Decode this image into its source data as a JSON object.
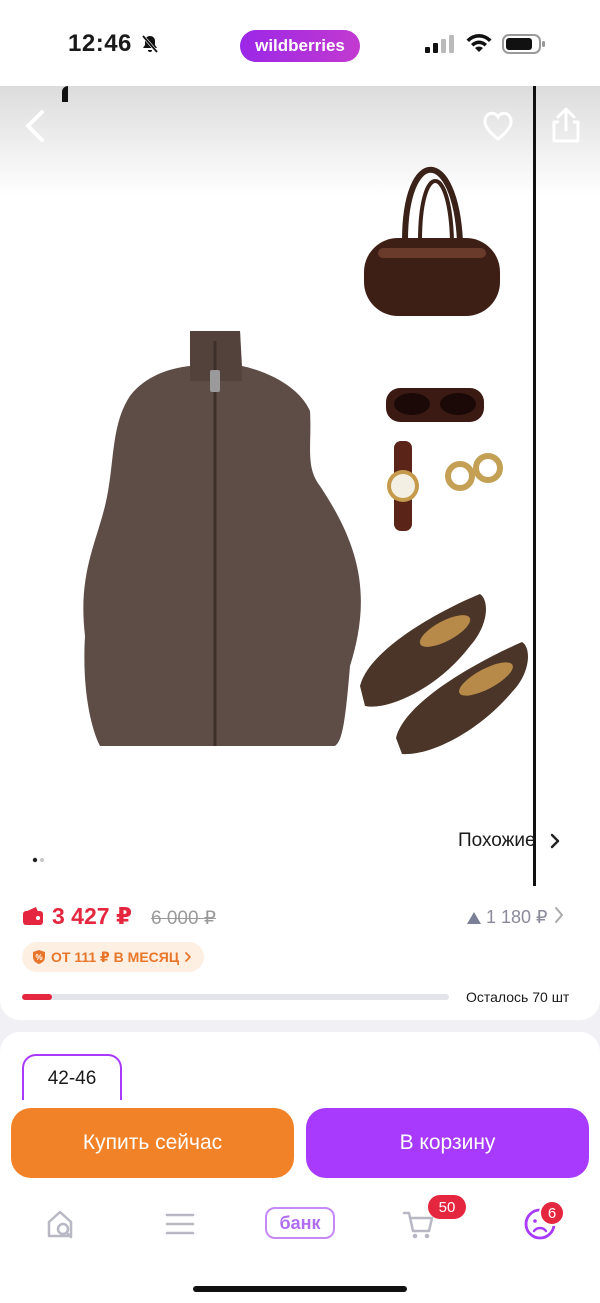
{
  "status_bar": {
    "time": "12:46",
    "app_badge": "wildberries"
  },
  "gallery": {
    "similar_label": "Похожие",
    "slide_index": 1,
    "slide_count": 2
  },
  "price": {
    "current": "3 427 ₽",
    "old": "6 000 ₽",
    "change": "1 180 ₽",
    "installment": "ОТ 111 ₽ В МЕСЯЦ",
    "stock_label": "Осталось 70 шт",
    "stock_fraction": 0.07
  },
  "size": {
    "selected": "42-46"
  },
  "actions": {
    "buy_now": "Купить сейчас",
    "add_to_cart": "В корзину"
  },
  "nav": {
    "bank_label": "банк",
    "cart_count": "50",
    "profile_count": "6"
  },
  "colors": {
    "brand_purple": "#a73afd",
    "buy_orange": "#f18228",
    "price_red": "#e5263f"
  }
}
